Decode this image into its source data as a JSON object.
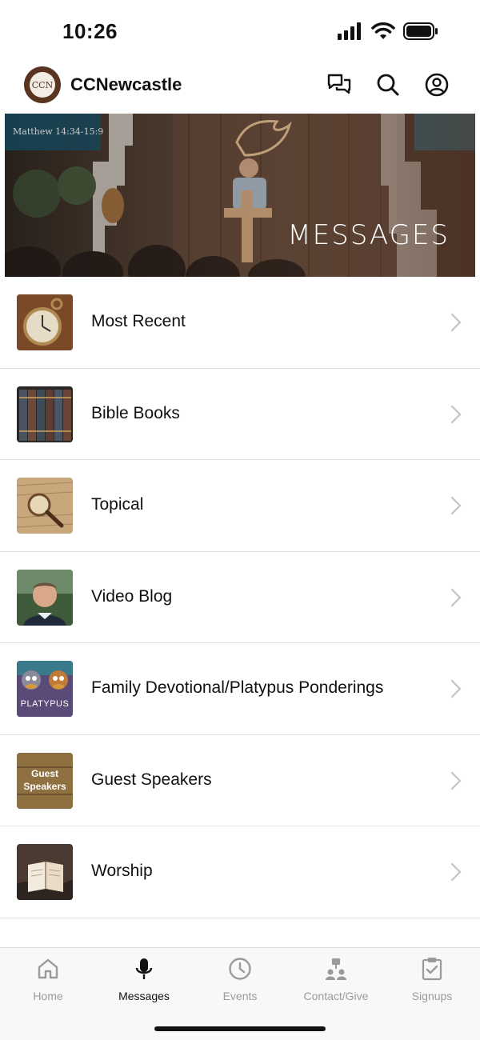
{
  "status_bar": {
    "time": "10:26"
  },
  "header": {
    "logo_text": "CCN",
    "title": "CCNewcastle",
    "icons": [
      "chat-icon",
      "search-icon",
      "profile-icon"
    ]
  },
  "banner": {
    "title": "MESSAGES",
    "screen_text": "Matthew 14:34-15:9"
  },
  "list": {
    "items": [
      {
        "label": "Most Recent",
        "icon": "pocket-watch-thumb"
      },
      {
        "label": "Bible Books",
        "icon": "books-thumb"
      },
      {
        "label": "Topical",
        "icon": "magnifier-thumb"
      },
      {
        "label": "Video Blog",
        "icon": "portrait-thumb"
      },
      {
        "label": "Family Devotional/Platypus Ponderings",
        "icon": "platypus-thumb",
        "thumb_text": "PLATYPUS"
      },
      {
        "label": "Guest Speakers",
        "icon": "guest-speakers-thumb",
        "thumb_text": "Guest Speakers"
      },
      {
        "label": "Worship",
        "icon": "open-bible-thumb"
      }
    ]
  },
  "tabs": [
    {
      "label": "Home",
      "icon": "home-icon",
      "active": false
    },
    {
      "label": "Messages",
      "icon": "microphone-icon",
      "active": true
    },
    {
      "label": "Events",
      "icon": "clock-icon",
      "active": false
    },
    {
      "label": "Contact/Give",
      "icon": "people-icon",
      "active": false
    },
    {
      "label": "Signups",
      "icon": "clipboard-check-icon",
      "active": false
    }
  ],
  "colors": {
    "brand": "#5a3420",
    "active_tab": "#111111",
    "inactive_tab": "#9a9a9a",
    "divider": "#e2e2e2"
  }
}
